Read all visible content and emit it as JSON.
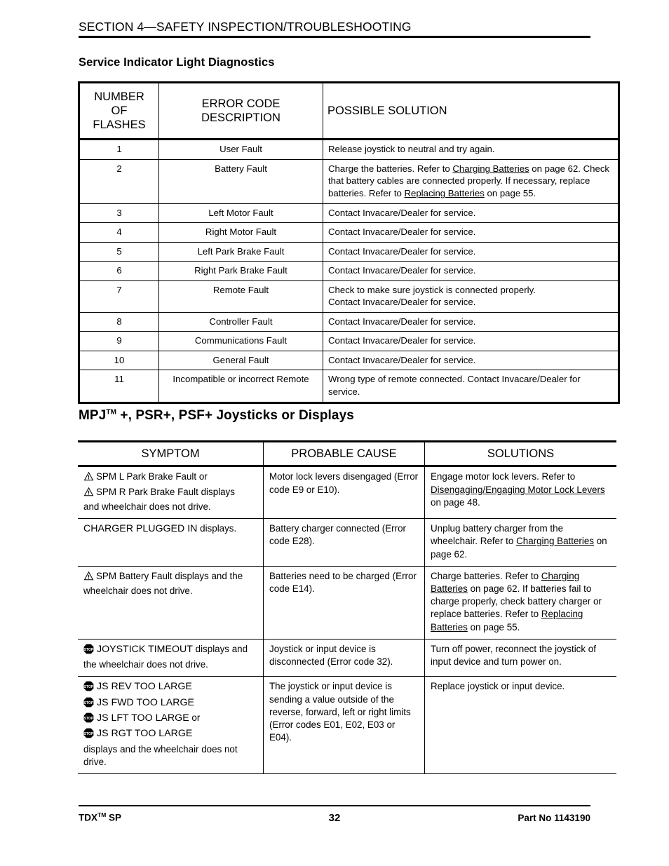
{
  "header": {
    "running_title": "SECTION 4—SAFETY INSPECTION/TROUBLESHOOTING",
    "sub_heading": "Service Indicator Light Diagnostics"
  },
  "table1": {
    "columns": [
      "NUMBER OF FLASHES",
      "ERROR CODE DESCRIPTION",
      "POSSIBLE SOLUTION"
    ],
    "col_num_line1": "NUMBER",
    "col_num_line2": "OF",
    "col_num_line3": "FLASHES",
    "col_desc_line1": "ERROR CODE",
    "col_desc_line2": "DESCRIPTION",
    "col_sol": "POSSIBLE SOLUTION",
    "rows": [
      {
        "flashes": "1",
        "description": "User Fault",
        "solution": "Release joystick to neutral and try again."
      },
      {
        "flashes": "2",
        "description": "Battery Fault",
        "solution_parts": [
          {
            "t": "Charge the batteries. Refer to "
          },
          {
            "t": "Charging Batteries",
            "u": true
          },
          {
            "t": " on page 62. Check that battery cables are connected properly. If necessary, replace batteries. Refer to "
          },
          {
            "t": "Replacing Batteries",
            "u": true
          },
          {
            "t": " on page 55."
          }
        ]
      },
      {
        "flashes": "3",
        "description": "Left Motor Fault",
        "solution": "Contact Invacare/Dealer for service."
      },
      {
        "flashes": "4",
        "description": "Right Motor Fault",
        "solution": "Contact Invacare/Dealer for service."
      },
      {
        "flashes": "5",
        "description": "Left Park Brake Fault",
        "solution": "Contact Invacare/Dealer for service."
      },
      {
        "flashes": "6",
        "description": "Right Park Brake Fault",
        "solution": "Contact Invacare/Dealer for service."
      },
      {
        "flashes": "7",
        "description": "Remote Fault",
        "solution_lines": [
          "Check to make sure joystick is connected properly.",
          "Contact Invacare/Dealer for service."
        ]
      },
      {
        "flashes": "8",
        "description": "Controller Fault",
        "solution": "Contact Invacare/Dealer for service."
      },
      {
        "flashes": "9",
        "description": "Communications Fault",
        "solution": "Contact Invacare/Dealer for service."
      },
      {
        "flashes": "10",
        "description": "General Fault",
        "solution": "Contact Invacare/Dealer for service."
      },
      {
        "flashes": "11",
        "description": "Incompatible or incorrect Remote",
        "solution": "Wrong type of remote connected. Contact Invacare/Dealer for service."
      }
    ]
  },
  "mpj_heading": {
    "text": "MPJ",
    "trademark": "TM",
    "rest": " +, PSR+, PSF+ Joysticks or Displays"
  },
  "table2": {
    "columns": [
      "SYMPTOM",
      "PROBABLE CAUSE",
      "SOLUTIONS"
    ],
    "rows": [
      {
        "symptom_lines": [
          {
            "icon": "warning-triangle-icon",
            "parts": [
              {
                "t": "SPM L Park Brake Fault or"
              }
            ]
          },
          {
            "icon": "warning-triangle-icon",
            "parts": [
              {
                "t": "SPM R Park Brake Fault displays"
              }
            ]
          },
          {
            "icon": null,
            "parts": [
              {
                "t": "and wheelchair does not drive."
              }
            ]
          }
        ],
        "cause": "Motor lock levers disengaged (Error code E9 or E10).",
        "solution_parts": [
          {
            "t": "Engage motor lock levers. Refer to "
          },
          {
            "t": "Disengaging/Engaging Motor Lock Levers",
            "u": true
          },
          {
            "t": " on page 48."
          }
        ]
      },
      {
        "symptom_lines": [
          {
            "icon": null,
            "parts": [
              {
                "t": "CHARGER PLUGGED IN",
                "caps": true
              },
              {
                "t": " displays."
              }
            ]
          }
        ],
        "cause": "Battery charger connected (Error code E28).",
        "solution_parts": [
          {
            "t": "Unplug battery charger from the wheelchair. Refer to "
          },
          {
            "t": "Charging Batteries",
            "u": true
          },
          {
            "t": " on page 62."
          }
        ]
      },
      {
        "symptom_lines": [
          {
            "icon": "warning-triangle-icon",
            "parts": [
              {
                "t": "SPM Battery Fault displays and the"
              }
            ]
          },
          {
            "icon": null,
            "parts": [
              {
                "t": "wheelchair does not drive."
              }
            ]
          }
        ],
        "cause": "Batteries need to be charged (Error code E14).",
        "solution_parts": [
          {
            "t": "Charge batteries. Refer to "
          },
          {
            "t": "Charging Batteries",
            "u": true
          },
          {
            "t": " on page 62. If batteries fail to charge properly, check battery charger or replace batteries. Refer to "
          },
          {
            "t": "Replacing Batteries",
            "u": true
          },
          {
            "t": " on page 55."
          }
        ]
      },
      {
        "symptom_lines": [
          {
            "icon": "stop-sign-icon",
            "parts": [
              {
                "t": "JOYSTICK TIMEOUT",
                "caps": true
              },
              {
                "t": " displays and"
              }
            ]
          },
          {
            "icon": null,
            "parts": [
              {
                "t": "the wheelchair does not drive."
              }
            ]
          }
        ],
        "cause": "Joystick or input device is disconnected (Error code 32).",
        "solution_parts": [
          {
            "t": "Turn off power, reconnect the joystick of input device and turn power on."
          }
        ]
      },
      {
        "symptom_lines": [
          {
            "icon": "stop-sign-icon",
            "parts": [
              {
                "t": "JS REV TOO LARGE",
                "caps": true
              }
            ]
          },
          {
            "icon": "stop-sign-icon",
            "parts": [
              {
                "t": "JS FWD TOO LARGE",
                "caps": true
              }
            ]
          },
          {
            "icon": "stop-sign-icon",
            "parts": [
              {
                "t": "JS LFT TOO LARGE",
                "caps": true
              },
              {
                "t": " or"
              }
            ]
          },
          {
            "icon": "stop-sign-icon",
            "parts": [
              {
                "t": "JS RGT TOO LARGE",
                "caps": true
              }
            ]
          },
          {
            "icon": null,
            "parts": [
              {
                "t": "displays and the wheelchair does not drive."
              }
            ]
          }
        ],
        "cause": "The joystick or input device is sending a value outside of the reverse, forward, left or right limits (Error codes E01, E02, E03 or E04).",
        "solution_parts": [
          {
            "t": "Replace joystick or input device."
          }
        ]
      }
    ]
  },
  "footer": {
    "left_text": "TDX",
    "left_trademark": "TM",
    "left_suffix": " SP",
    "page_number": "32",
    "right_text": "Part No 1143190"
  },
  "colors": {
    "text": "#000000",
    "rule": "#000000",
    "background": "#ffffff"
  }
}
